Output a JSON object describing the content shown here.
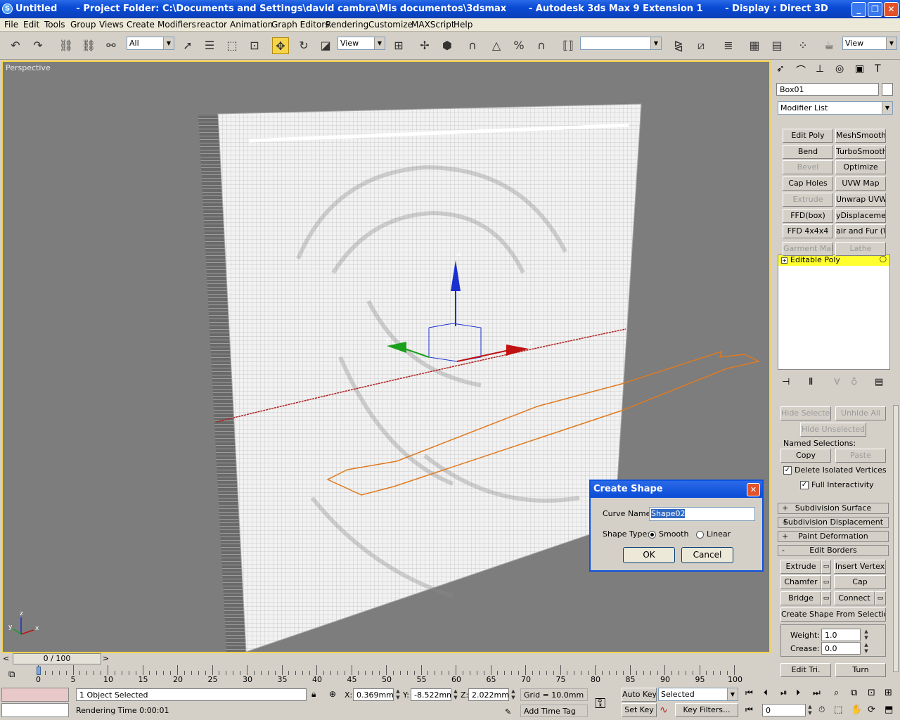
{
  "window": {
    "title": "Untitled      - Project Folder: C:\\Documents and Settings\\david cambra\\Mis documentos\\3dsmax       - Autodesk 3ds Max 9 Extension 1       - Display : Direct 3D",
    "min": "_",
    "max": "❐",
    "close": "✕"
  },
  "menu": [
    "File",
    "Edit",
    "Tools",
    "Group",
    "Views",
    "Create",
    "Modifiers",
    "reactor",
    "Animation",
    "Graph Editors",
    "Rendering",
    "Customize",
    "MAXScript",
    "Help"
  ],
  "toolbar": {
    "selection_filter": "All",
    "ref_coord": "View",
    "named_selection": "",
    "render_view": "View"
  },
  "viewport": {
    "label": "Perspective"
  },
  "time": {
    "frame_label": "0 / 100",
    "ticks": [
      "0",
      "5",
      "10",
      "15",
      "20",
      "25",
      "30",
      "35",
      "40",
      "45",
      "50",
      "55",
      "60",
      "65",
      "70",
      "75",
      "80",
      "85",
      "90",
      "95",
      "100"
    ]
  },
  "status": {
    "selected": "1 Object Selected",
    "prompt": "Rendering Time  0:00:01",
    "x_label": "X:",
    "x": "0.369mm",
    "y_label": "Y:",
    "y": "-8.522mm",
    "z_label": "Z:",
    "z": "2.022mm",
    "grid": "Grid = 10.0mm",
    "add_time_tag": "Add Time Tag",
    "auto_key": "Auto Key",
    "set_key": "Set Key",
    "key_mode": "Selected",
    "key_filters": "Key Filters...",
    "frame": "0"
  },
  "cmdpanel": {
    "object_name": "Box01",
    "modifier_list": "Modifier List",
    "mod_buttons": [
      {
        "label": "Edit Poly",
        "enabled": true
      },
      {
        "label": "MeshSmooth",
        "enabled": true
      },
      {
        "label": "Bend",
        "enabled": true
      },
      {
        "label": "TurboSmooth",
        "enabled": true
      },
      {
        "label": "Bevel",
        "enabled": false
      },
      {
        "label": "Optimize",
        "enabled": true
      },
      {
        "label": "Cap Holes",
        "enabled": true
      },
      {
        "label": "UVW Map",
        "enabled": true
      },
      {
        "label": "Extrude",
        "enabled": false
      },
      {
        "label": "Unwrap UVW",
        "enabled": true
      },
      {
        "label": "FFD(box)",
        "enabled": true
      },
      {
        "label": "yDisplacement",
        "enabled": true
      },
      {
        "label": "FFD 4x4x4",
        "enabled": true
      },
      {
        "label": "air and Fur (WS",
        "enabled": true
      },
      {
        "label": "Garment Make",
        "enabled": false
      },
      {
        "label": "Lathe",
        "enabled": false
      }
    ],
    "stack_item": "Editable Poly",
    "hide_selected": "Hide Selected",
    "unhide_all": "Unhide All",
    "hide_unselected": "Hide Unselected",
    "named_selections": "Named Selections:",
    "copy": "Copy",
    "paste": "Paste",
    "delete_isolated": "Delete Isolated Vertices",
    "full_interactivity": "Full Interactivity",
    "rollouts": [
      "Subdivision Surface",
      "Subdivision Displacement",
      "Paint Deformation"
    ],
    "edit_borders": "Edit Borders",
    "extrude": "Extrude",
    "insert_vertex": "Insert Vertex",
    "chamfer": "Chamfer",
    "cap": "Cap",
    "bridge": "Bridge",
    "connect": "Connect",
    "create_shape": "Create Shape From Selection",
    "weight_label": "Weight:",
    "weight": "1.0",
    "crease_label": "Crease:",
    "crease": "0.0",
    "edit_tri": "Edit Tri.",
    "turn": "Turn",
    "plus": "+",
    "minus": "-"
  },
  "dialog": {
    "title": "Create Shape",
    "curve_name_label": "Curve Name:",
    "curve_name": "Shape02",
    "shape_type_label": "Shape Type:",
    "smooth": "Smooth",
    "linear": "Linear",
    "ok": "OK",
    "cancel": "Cancel"
  },
  "gizmo": {
    "x": "x",
    "y": "y",
    "z": "z"
  },
  "colors": {
    "accent": "#f5d44a",
    "title_blue": "#0a4bd6",
    "viewport": "#7d7d7d"
  }
}
